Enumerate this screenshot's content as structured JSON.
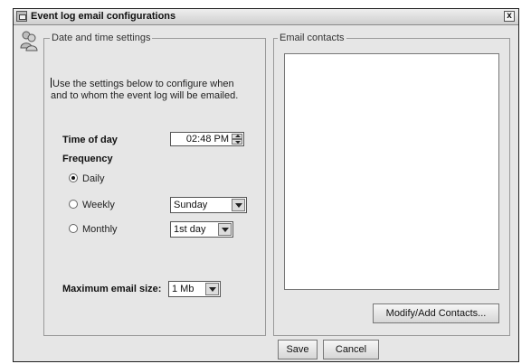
{
  "window": {
    "title": "Event log email configurations",
    "close_glyph": "x"
  },
  "date_time_group": {
    "legend": "Date and time settings",
    "intro": "Use the settings below to configure when and to whom the event log will be emailed.",
    "time_of_day_label": "Time of day",
    "time_of_day_value": "02:48 PM",
    "frequency_label": "Frequency",
    "frequency_options": [
      {
        "label": "Daily",
        "checked": true
      },
      {
        "label": "Weekly",
        "checked": false
      },
      {
        "label": "Monthly",
        "checked": false
      }
    ],
    "weekly_select": "Sunday",
    "monthly_select": "1st day",
    "max_size_label": "Maximum email size:",
    "max_size_select": "1 Mb"
  },
  "contacts_group": {
    "legend": "Email contacts",
    "modify_button": "Modify/Add Contacts..."
  },
  "footer": {
    "save_button": "Save",
    "cancel_button": "Cancel"
  },
  "icons": {
    "title": "window-app-icon",
    "side": "people-icon",
    "close": "close-icon",
    "spin_up": "arrow-up-icon",
    "spin_down": "arrow-down-icon",
    "dropdown": "chevron-down-icon"
  }
}
